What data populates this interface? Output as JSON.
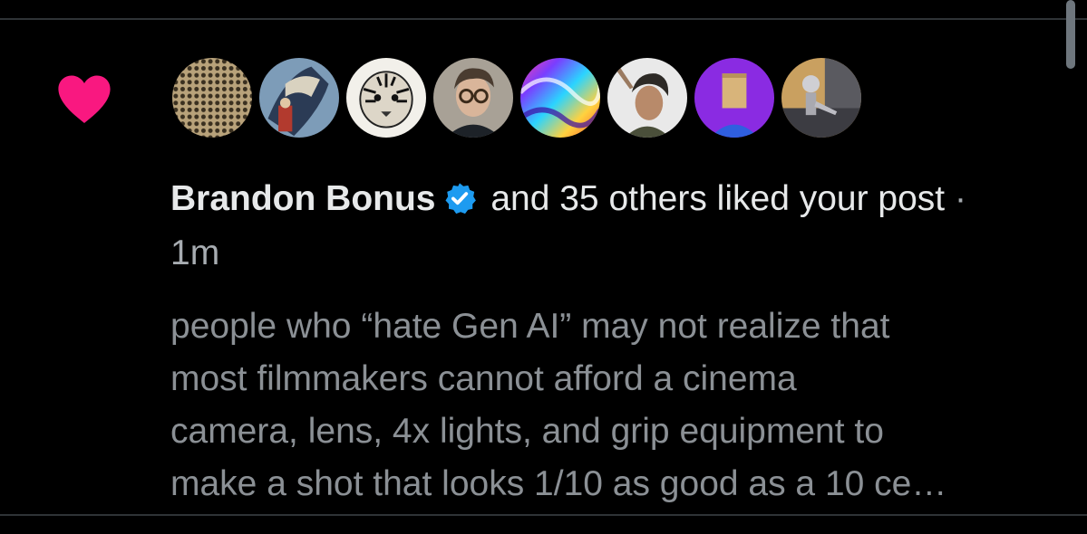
{
  "notification": {
    "type": "like",
    "actor_name": "Brandon Bonus",
    "actor_verified": true,
    "action_text": "and 35 others liked your post",
    "separator": "·",
    "time_ago": "1m",
    "post_excerpt": "people who “hate Gen AI” may not realize that\nmost filmmakers cannot afford a cinema\ncamera, lens, 4x lights, and grip equipment to\nmake a shot that looks 1/10 as good as a 10 ce…",
    "avatars": [
      {
        "name": "avatar-mesh-pattern"
      },
      {
        "name": "avatar-comic-hero"
      },
      {
        "name": "avatar-tiger-sketch"
      },
      {
        "name": "avatar-man-glasses"
      },
      {
        "name": "avatar-rainbow-swirl"
      },
      {
        "name": "avatar-game-character"
      },
      {
        "name": "avatar-paper-bag-head"
      },
      {
        "name": "avatar-robot-skeleton"
      }
    ]
  },
  "colors": {
    "background": "#000000",
    "heart": "#f91880",
    "verified": "#1d9bf0",
    "primary_text": "#e7e9ea",
    "secondary_text": "#8b9095",
    "divider": "#2f3336"
  }
}
